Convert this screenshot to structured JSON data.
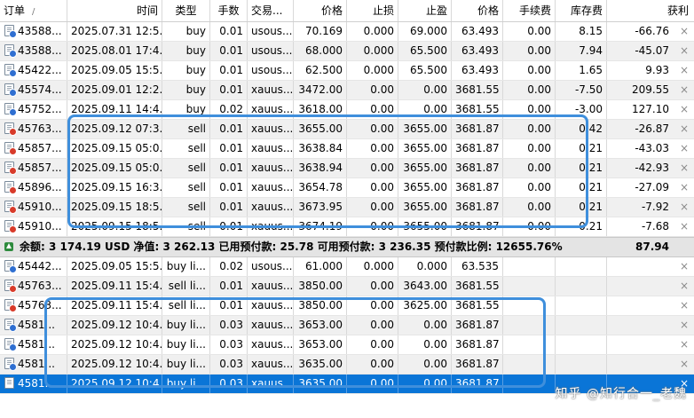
{
  "headers": {
    "order": "订单",
    "sort_mark": "/",
    "time": "时间",
    "type": "类型",
    "volume": "手数",
    "symbol": "交易...",
    "price": "价格",
    "sl": "止损",
    "tp": "止盈",
    "cur_price": "价格",
    "commission": "手续费",
    "swap": "库存费",
    "profit": "获利"
  },
  "positions": [
    {
      "id": "43588...",
      "time": "2025.07.31 12:5...",
      "type": "buy",
      "vol": "0.01",
      "sym": "usous...",
      "price": "70.169",
      "sl": "0.000",
      "tp": "69.000",
      "cur": "63.493",
      "comm": "0.00",
      "swap": "8.15",
      "profit": "-66.76",
      "dot": "blue"
    },
    {
      "id": "43588...",
      "time": "2025.08.01 17:4...",
      "type": "buy",
      "vol": "0.01",
      "sym": "usous...",
      "price": "68.000",
      "sl": "0.000",
      "tp": "65.500",
      "cur": "63.493",
      "comm": "0.00",
      "swap": "7.94",
      "profit": "-45.07",
      "dot": "blue"
    },
    {
      "id": "45422...",
      "time": "2025.09.05 15:5...",
      "type": "buy",
      "vol": "0.01",
      "sym": "usous...",
      "price": "62.500",
      "sl": "0.000",
      "tp": "65.500",
      "cur": "63.493",
      "comm": "0.00",
      "swap": "1.65",
      "profit": "9.93",
      "dot": "blue"
    },
    {
      "id": "45574...",
      "time": "2025.09.01 12:2...",
      "type": "buy",
      "vol": "0.01",
      "sym": "xauus...",
      "price": "3472.00",
      "sl": "0.00",
      "tp": "0.00",
      "cur": "3681.55",
      "comm": "0.00",
      "swap": "-7.50",
      "profit": "209.55",
      "dot": "blue"
    },
    {
      "id": "45752...",
      "time": "2025.09.11 14:4...",
      "type": "buy",
      "vol": "0.02",
      "sym": "xauus...",
      "price": "3618.00",
      "sl": "0.00",
      "tp": "0.00",
      "cur": "3681.55",
      "comm": "0.00",
      "swap": "-3.00",
      "profit": "127.10",
      "dot": "blue"
    },
    {
      "id": "45763...",
      "time": "2025.09.12 07:3...",
      "type": "sell",
      "vol": "0.01",
      "sym": "xauus...",
      "price": "3655.00",
      "sl": "0.00",
      "tp": "3655.00",
      "cur": "3681.87",
      "comm": "0.00",
      "swap": "0.42",
      "profit": "-26.87",
      "dot": "red"
    },
    {
      "id": "45857...",
      "time": "2025.09.15 05:0...",
      "type": "sell",
      "vol": "0.01",
      "sym": "xauus...",
      "price": "3638.84",
      "sl": "0.00",
      "tp": "3655.00",
      "cur": "3681.87",
      "comm": "0.00",
      "swap": "0.21",
      "profit": "-43.03",
      "dot": "red"
    },
    {
      "id": "45857...",
      "time": "2025.09.15 05:0...",
      "type": "sell",
      "vol": "0.01",
      "sym": "xauus...",
      "price": "3638.94",
      "sl": "0.00",
      "tp": "3655.00",
      "cur": "3681.87",
      "comm": "0.00",
      "swap": "0.21",
      "profit": "-42.93",
      "dot": "red"
    },
    {
      "id": "45896...",
      "time": "2025.09.15 16:3...",
      "type": "sell",
      "vol": "0.01",
      "sym": "xauus...",
      "price": "3654.78",
      "sl": "0.00",
      "tp": "3655.00",
      "cur": "3681.87",
      "comm": "0.00",
      "swap": "0.21",
      "profit": "-27.09",
      "dot": "red"
    },
    {
      "id": "45910...",
      "time": "2025.09.15 18:5...",
      "type": "sell",
      "vol": "0.01",
      "sym": "xauus...",
      "price": "3673.95",
      "sl": "0.00",
      "tp": "3655.00",
      "cur": "3681.87",
      "comm": "0.00",
      "swap": "0.21",
      "profit": "-7.92",
      "dot": "red"
    },
    {
      "id": "45910...",
      "time": "2025.09.15 18:5...",
      "type": "sell",
      "vol": "0.01",
      "sym": "xauus...",
      "price": "3674.19",
      "sl": "0.00",
      "tp": "3655.00",
      "cur": "3681.87",
      "comm": "0.00",
      "swap": "0.21",
      "profit": "-7.68",
      "dot": "red"
    }
  ],
  "summary": {
    "text": "余额: 3 174.19 USD  净值: 3 262.13  已用预付款: 25.78  可用预付款: 3 236.35  预付款比例: 12655.76%",
    "total": "87.94"
  },
  "pending": [
    {
      "id": "45442...",
      "time": "2025.09.05 15:5...",
      "type": "buy li...",
      "vol": "0.02",
      "sym": "usous...",
      "price": "61.000",
      "sl": "0.000",
      "tp": "0.000",
      "cur": "63.535",
      "dot": "blue"
    },
    {
      "id": "45763...",
      "time": "2025.09.11 15:4...",
      "type": "sell li...",
      "vol": "0.01",
      "sym": "xauus...",
      "price": "3850.00",
      "sl": "0.00",
      "tp": "3643.00",
      "cur": "3681.55",
      "dot": "red"
    },
    {
      "id": "45763...",
      "time": "2025.09.11 15:4...",
      "type": "sell li...",
      "vol": "0.01",
      "sym": "xauus...",
      "price": "3850.00",
      "sl": "0.00",
      "tp": "3625.00",
      "cur": "3681.55",
      "dot": "red"
    },
    {
      "id": "4581...",
      "time": "2025.09.12 10:4...",
      "type": "buy li...",
      "vol": "0.03",
      "sym": "xauus...",
      "price": "3653.00",
      "sl": "0.00",
      "tp": "0.00",
      "cur": "3681.87",
      "dot": "blue"
    },
    {
      "id": "4581...",
      "time": "2025.09.12 10:4...",
      "type": "buy li...",
      "vol": "0.03",
      "sym": "xauus...",
      "price": "3653.00",
      "sl": "0.00",
      "tp": "0.00",
      "cur": "3681.87",
      "dot": "blue"
    },
    {
      "id": "4581...",
      "time": "2025.09.12 10:4...",
      "type": "buy li...",
      "vol": "0.03",
      "sym": "xauus...",
      "price": "3635.00",
      "sl": "0.00",
      "tp": "0.00",
      "cur": "3681.87",
      "dot": "blue"
    },
    {
      "id": "4581...",
      "time": "2025.09.12 10:4...",
      "type": "buy li...",
      "vol": "0.03",
      "sym": "xauus...",
      "price": "3635.00",
      "sl": "0.00",
      "tp": "0.00",
      "cur": "3681.87",
      "dot": "none",
      "selected": true
    }
  ],
  "close_glyph": "×",
  "watermark": "知乎 @知行合一_老魏",
  "colors": {
    "selection": "#0a75d7",
    "highlight_box": "#3f8fdc",
    "buy_marker": "#2f6fd1",
    "sell_marker": "#d83b2a",
    "summary_up": "#2e8b3d"
  }
}
